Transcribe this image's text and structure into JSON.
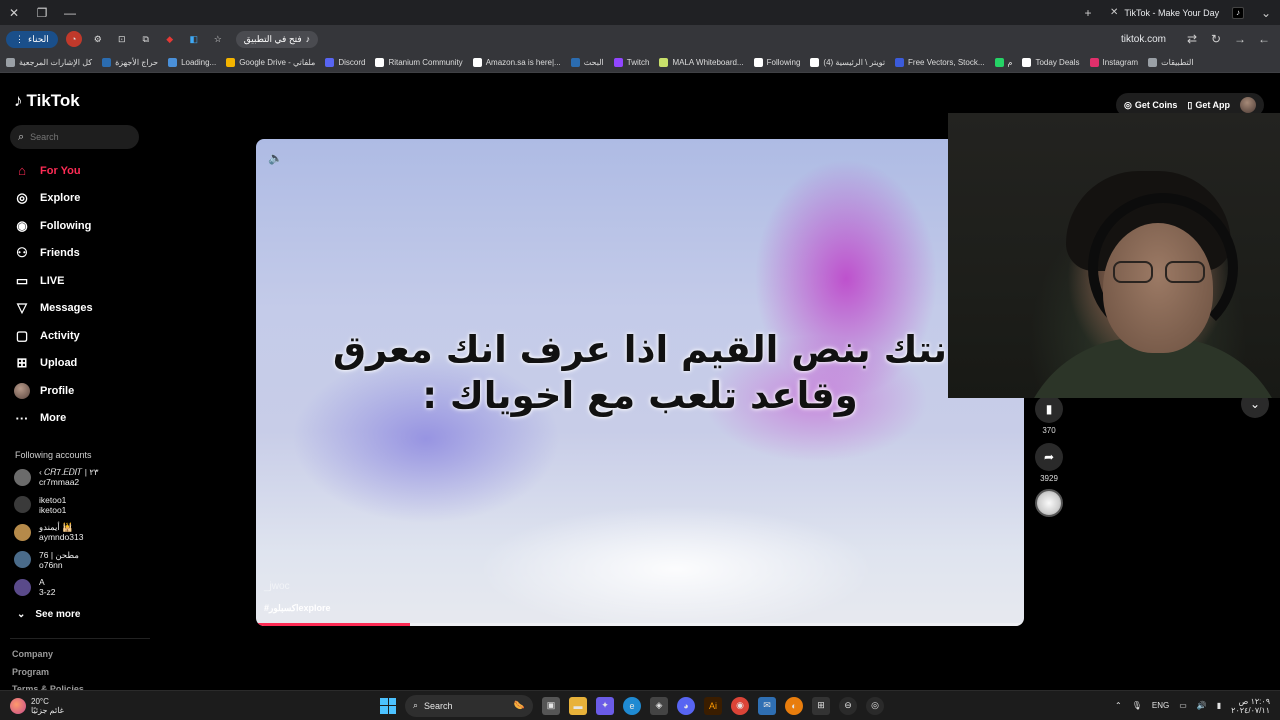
{
  "browser": {
    "tab_title": "TikTok - Make Your Day",
    "url": "tiktok.com",
    "profile_chip": "الحناء",
    "open_in_app": "فتح في التطبيق",
    "bookmarks": [
      {
        "label": "كل الإشارات المرجعية",
        "color": "#9aa0a6"
      },
      {
        "label": "حراج الأجهزة",
        "color": "#2b6cb0"
      },
      {
        "label": "Loading...",
        "color": "#4a90d9"
      },
      {
        "label": "Google Drive - ملفاتي",
        "color": "#f4b400"
      },
      {
        "label": "Discord",
        "color": "#5865f2"
      },
      {
        "label": "Ritanium Community",
        "color": "#ffffff"
      },
      {
        "label": "Amazon.sa is here|...",
        "color": "#ffffff"
      },
      {
        "label": "البحث",
        "color": "#2b6cb0"
      },
      {
        "label": "Twitch",
        "color": "#9146ff"
      },
      {
        "label": "MALA Whiteboard...",
        "color": "#c8e06b"
      },
      {
        "label": "Following",
        "color": "#ffffff"
      },
      {
        "label": "(4) تويتر \\ الرئيسية",
        "color": "#ffffff"
      },
      {
        "label": "Free Vectors, Stock...",
        "color": "#3b5bdb"
      },
      {
        "label": "م",
        "color": "#25d366"
      },
      {
        "label": "Today Deals",
        "color": "#ffffff"
      },
      {
        "label": "Instagram",
        "color": "#e1306c"
      },
      {
        "label": "التطبيقات",
        "color": "#9aa0a6"
      }
    ]
  },
  "sidebar": {
    "logo": "TikTok",
    "search_placeholder": "Search",
    "nav": [
      {
        "label": "For You",
        "icon": "home-icon",
        "glyph": "⌂",
        "active": true
      },
      {
        "label": "Explore",
        "icon": "compass-icon",
        "glyph": "◎",
        "active": false
      },
      {
        "label": "Following",
        "icon": "following-icon",
        "glyph": "◉",
        "active": false
      },
      {
        "label": "Friends",
        "icon": "friends-icon",
        "glyph": "⚇",
        "active": false
      },
      {
        "label": "LIVE",
        "icon": "live-icon",
        "glyph": "▭",
        "active": false
      },
      {
        "label": "Messages",
        "icon": "messages-icon",
        "glyph": "▽",
        "active": false
      },
      {
        "label": "Activity",
        "icon": "activity-icon",
        "glyph": "▢",
        "active": false
      },
      {
        "label": "Upload",
        "icon": "upload-icon",
        "glyph": "⊞",
        "active": false
      },
      {
        "label": "Profile",
        "icon": "profile-avatar",
        "glyph": "",
        "active": false
      },
      {
        "label": "More",
        "icon": "more-icon",
        "glyph": "···",
        "active": false
      }
    ],
    "following_title": "Following accounts",
    "accounts": [
      {
        "name": "‹ 𝐶𝑅7.𝐸𝐷𝐼𝑇 | ٢٣",
        "handle": "cr7mmaa2",
        "color": "#6b6b6b"
      },
      {
        "name": "iketoo1",
        "handle": "iketoo1",
        "color": "#3a3a3a"
      },
      {
        "name": "أيمندو 🕌",
        "handle": "aymndo313",
        "color": "#b58a4a"
      },
      {
        "name": "76 | مطحن",
        "handle": "o76nn",
        "color": "#4a6b8a"
      },
      {
        "name": "A",
        "handle": "3-z2",
        "color": "#5a4a8a"
      }
    ],
    "see_more": "See more",
    "footer": [
      "Company",
      "Program",
      "Terms & Policies"
    ]
  },
  "header": {
    "get_coins": "Get Coins",
    "get_app": "Get App"
  },
  "video": {
    "caption_line1": "نتك بنص القيم اذا عرف انك معرق",
    "caption_line2": "وقاعد تلعب مع اخوياك :",
    "username": "_jwoc",
    "hashtag": "#اكسبلورexplore",
    "progress": 0.2
  },
  "actions": {
    "bookmarks": "370",
    "shares": "3929"
  },
  "taskbar": {
    "temp": "20°C",
    "weather_desc": "غائم جزئيًا",
    "search_label": "Search",
    "lang": "ENG",
    "time": "١٢:٠٩ ص",
    "date": "٢٠٢٤/٠٧/١١"
  }
}
